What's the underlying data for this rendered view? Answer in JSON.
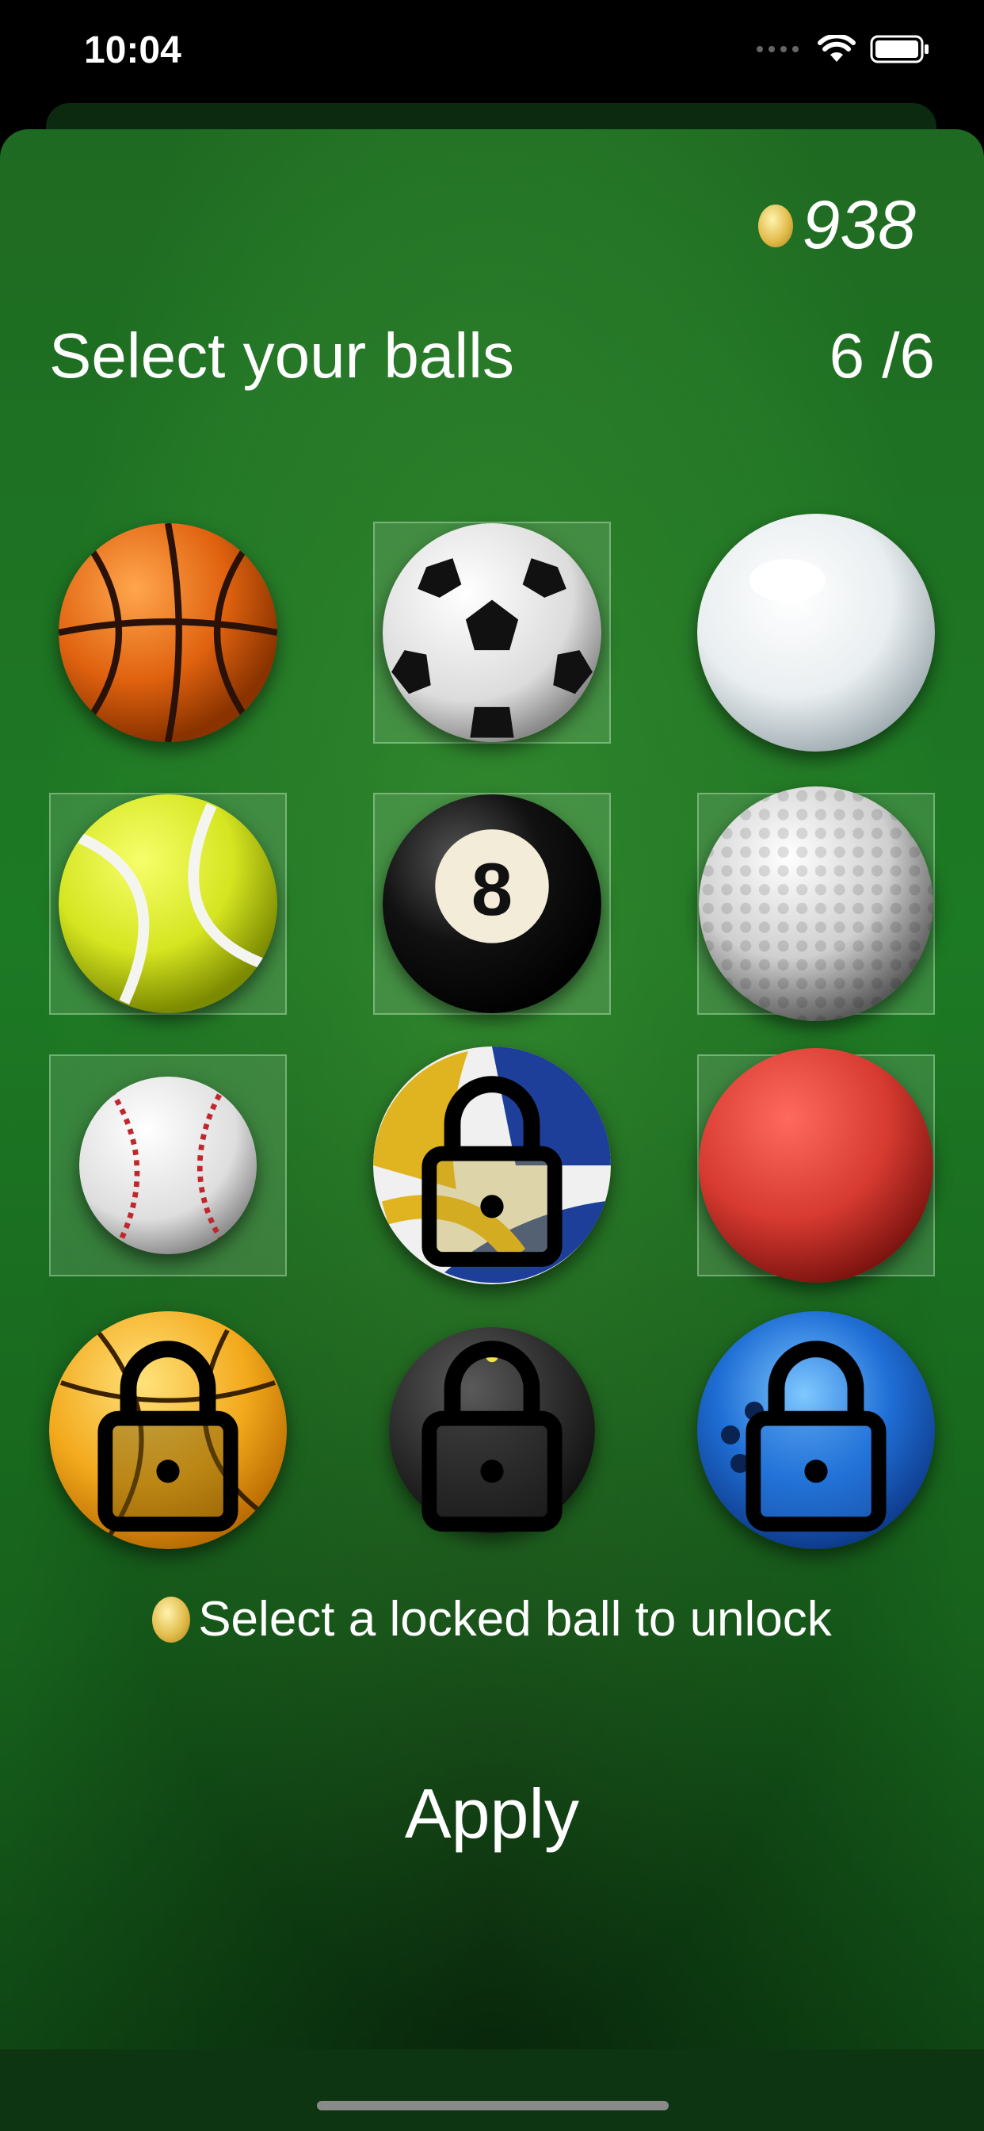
{
  "status_bar": {
    "time": "10:04"
  },
  "header": {
    "coin_count": "938"
  },
  "title": "Select your balls",
  "selection_count": "6 /6",
  "balls": [
    {
      "name": "basketball",
      "selected": false,
      "locked": false
    },
    {
      "name": "soccer-ball",
      "selected": true,
      "locked": false
    },
    {
      "name": "pearl-ball",
      "selected": false,
      "locked": false
    },
    {
      "name": "tennis-ball",
      "selected": true,
      "locked": false
    },
    {
      "name": "eight-ball",
      "selected": true,
      "locked": false
    },
    {
      "name": "golf-ball",
      "selected": true,
      "locked": false
    },
    {
      "name": "baseball",
      "selected": true,
      "locked": false
    },
    {
      "name": "volleyball",
      "selected": false,
      "locked": true
    },
    {
      "name": "dodgeball",
      "selected": true,
      "locked": false
    },
    {
      "name": "water-polo-ball",
      "selected": false,
      "locked": true
    },
    {
      "name": "black-ball",
      "selected": false,
      "locked": true
    },
    {
      "name": "bowling-ball",
      "selected": false,
      "locked": true
    }
  ],
  "hint": "Select a locked ball to unlock",
  "apply_label": "Apply",
  "colors": {
    "felt_green": "#1d7a24",
    "coin_gold": "#e2bd4c",
    "text": "#ffffff"
  }
}
